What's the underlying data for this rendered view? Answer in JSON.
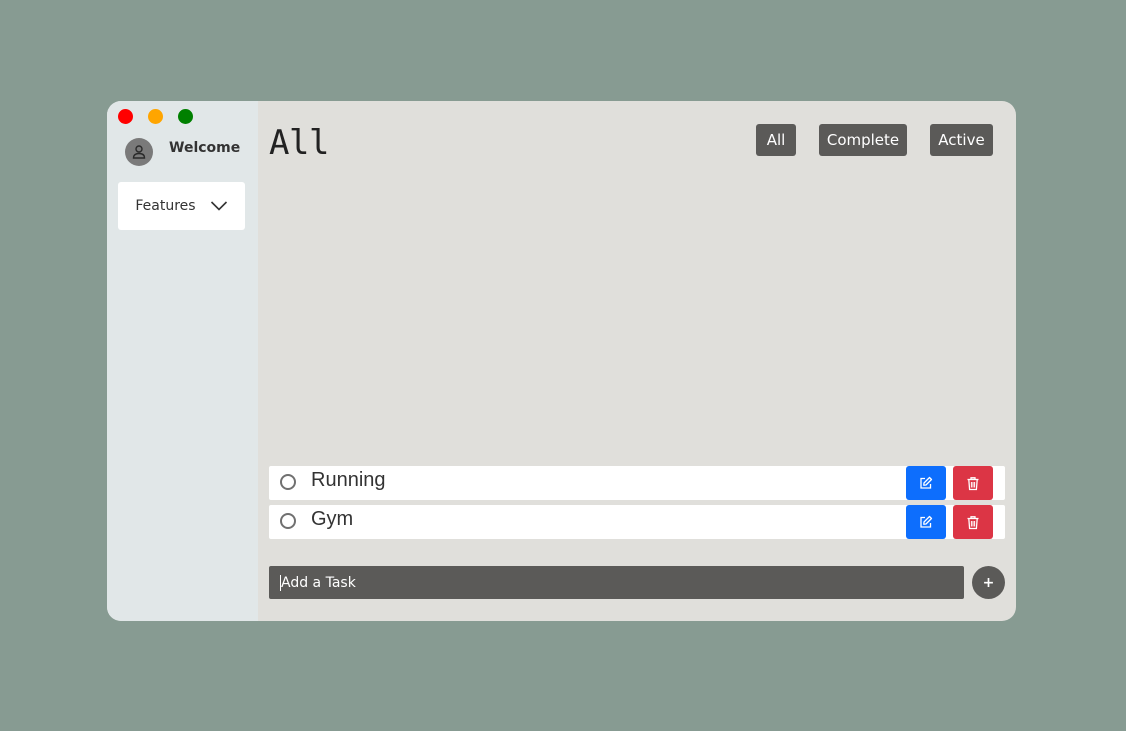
{
  "window": {
    "controls": [
      {
        "name": "close",
        "color": "#ff0000"
      },
      {
        "name": "minimize",
        "color": "#ffa500"
      },
      {
        "name": "maximize",
        "color": "#008000"
      }
    ]
  },
  "sidebar": {
    "welcome": "Welcome",
    "features_label": "Features",
    "icons": {
      "avatar": "user-icon",
      "dropdown": "chevron-down-icon"
    }
  },
  "main": {
    "title": "All",
    "filters": [
      {
        "label": "All"
      },
      {
        "label": "Complete"
      },
      {
        "label": "Active"
      }
    ],
    "tasks": [
      {
        "name": "Running",
        "done": false
      },
      {
        "name": "Gym",
        "done": false
      }
    ],
    "add_task": {
      "placeholder": "Add a Task",
      "button_label": "+"
    }
  },
  "colors": {
    "page_background": "#879b92",
    "sidebar_background": "#e1e7e8",
    "main_background": "#e0dfdb",
    "dark_button": "#5b5a58",
    "edit_button": "#0d6efd",
    "delete_button": "#dc3545"
  }
}
